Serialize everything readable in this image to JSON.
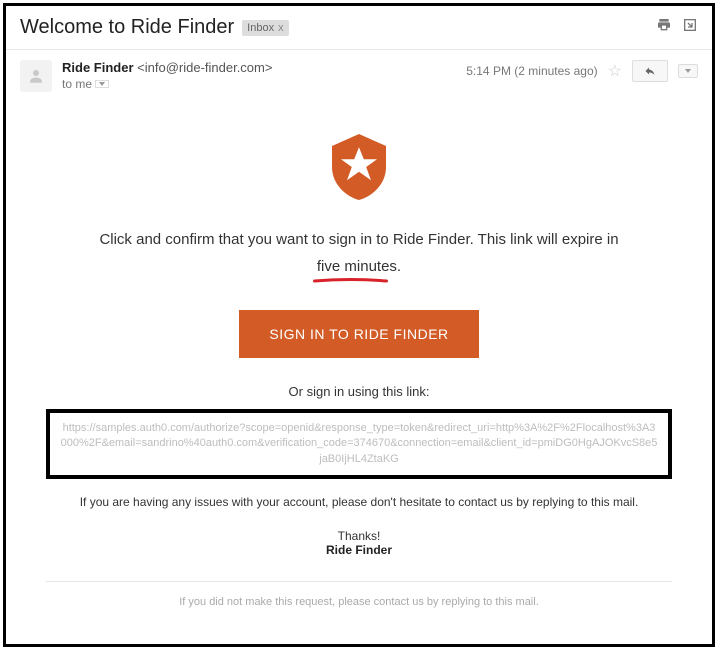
{
  "header": {
    "subject": "Welcome to Ride Finder",
    "tag_label": "Inbox",
    "tag_close": "x"
  },
  "meta": {
    "from_name": "Ride Finder",
    "from_email": "<info@ride-finder.com>",
    "to_label": "to me",
    "time": "5:14 PM (2 minutes ago)"
  },
  "body": {
    "line1": "Click and confirm that you want to sign in to Ride Finder. This link will expire in",
    "emphasized": "five minutes.",
    "cta": "SIGN IN TO RIDE FINDER",
    "or_text": "Or sign in using this link:",
    "link": "https://samples.auth0.com/authorize?scope=openid&response_type=token&redirect_uri=http%3A%2F%2Flocalhost%3A3000%2F&email=sandrino%40auth0.com&verification_code=374670&connection=email&client_id=pmiDG0HgAJOKvcS8e5jaB0IjHL4ZtaKG",
    "help": "If you are having any issues with your account, please don't hesitate to contact us by replying to this mail.",
    "thanks": "Thanks!",
    "signoff": "Ride Finder",
    "footer": "If you did not make this request, please contact us by replying to this mail."
  },
  "colors": {
    "brand": "#d35b26",
    "underline": "#d8232a"
  }
}
